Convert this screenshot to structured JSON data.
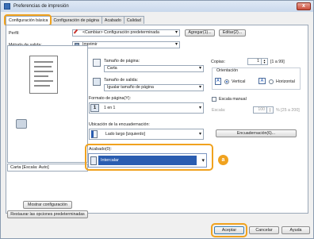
{
  "window": {
    "title": "Preferencias de impresión",
    "close": "x"
  },
  "tabs": [
    {
      "label": "Configuración básica",
      "active": true
    },
    {
      "label": "Configuración de página"
    },
    {
      "label": "Acabado"
    },
    {
      "label": "Calidad"
    }
  ],
  "profile": {
    "label": "Perfil:",
    "value": "<Cambiar> Configuración predeterminada",
    "add_button": "Agregar(1)...",
    "edit_button": "Editar(2)..."
  },
  "output_method": {
    "label": "Método de salida:",
    "value": "Imprimir"
  },
  "preview": {
    "status": "Carta [Escala: Auto]"
  },
  "page_size": {
    "label": "Tamaño de página:",
    "value": "Carta"
  },
  "output_size": {
    "label": "Tamaño de salida:",
    "value": "Igualar tamaño de página"
  },
  "copies": {
    "label": "Copias:",
    "value": "1",
    "range": "[1 a 99]"
  },
  "orientation": {
    "label": "Orientación",
    "vertical": "Vertical",
    "horizontal": "Horizontal",
    "selected": "Vertical"
  },
  "page_format": {
    "label": "Formato de página(Y):",
    "value": "1 en 1"
  },
  "manual_scale": {
    "label": "Escala manual"
  },
  "scale": {
    "label": "Escala:",
    "value": "100",
    "range": "% [25 a 200]"
  },
  "binding": {
    "label": "Ubicación de la encuadernación:",
    "value": "Lado largo [izquierdo]",
    "button": "Encuadernación(6)..."
  },
  "finishing": {
    "label": "Acabado(0):",
    "value": "Intercalar",
    "callout": "a"
  },
  "left_buttons": {
    "show_config": "Mostrar configuración",
    "restore_defaults": "Restaurar las opciones predeterminadas"
  },
  "footer": {
    "accept": "Aceptar",
    "cancel": "Cancelar",
    "help": "Ayuda"
  },
  "colors": {
    "accent": "#f0a21e",
    "selection": "#2a5db0"
  }
}
